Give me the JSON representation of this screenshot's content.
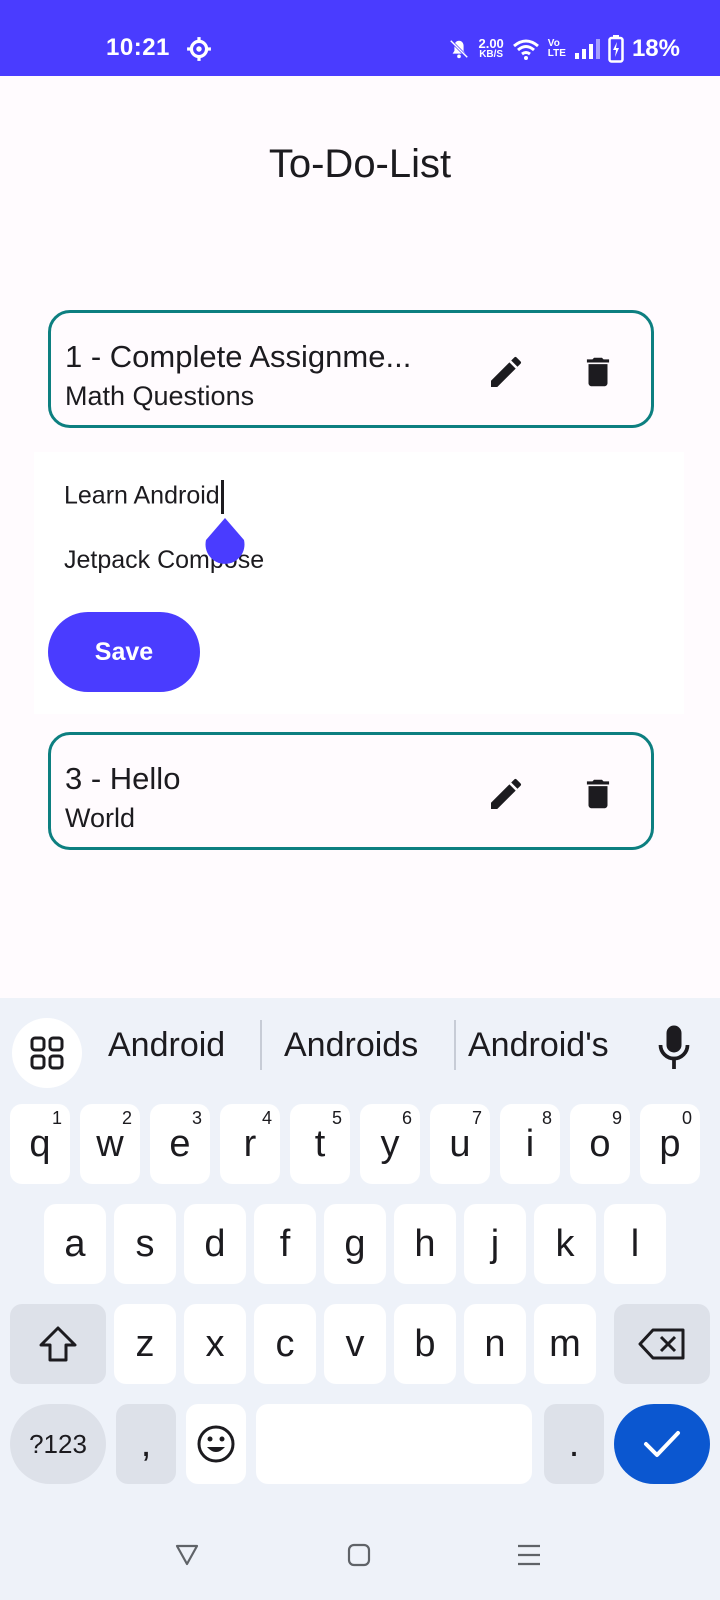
{
  "status_bar": {
    "time": "10:21",
    "net_speed_value": "2.00",
    "net_speed_unit": "KB/S",
    "volte_top": "Vo",
    "volte_bottom": "LTE",
    "battery": "18%"
  },
  "app": {
    "title": "To-Do-List"
  },
  "todos": [
    {
      "title": "1 - Complete Assignme...",
      "subtitle": "Math Questions"
    },
    {
      "title": "3 - Hello",
      "subtitle": "World"
    }
  ],
  "edit": {
    "title_value": "Learn Android",
    "description_value": "Jetpack Compose",
    "save_label": "Save"
  },
  "keyboard": {
    "suggestions": [
      "Android",
      "Androids",
      "Android's"
    ],
    "row1": [
      {
        "key": "q",
        "hint": "1"
      },
      {
        "key": "w",
        "hint": "2"
      },
      {
        "key": "e",
        "hint": "3"
      },
      {
        "key": "r",
        "hint": "4"
      },
      {
        "key": "t",
        "hint": "5"
      },
      {
        "key": "y",
        "hint": "6"
      },
      {
        "key": "u",
        "hint": "7"
      },
      {
        "key": "i",
        "hint": "8"
      },
      {
        "key": "o",
        "hint": "9"
      },
      {
        "key": "p",
        "hint": "0"
      }
    ],
    "row2": [
      "a",
      "s",
      "d",
      "f",
      "g",
      "h",
      "j",
      "k",
      "l"
    ],
    "row3": [
      "z",
      "x",
      "c",
      "v",
      "b",
      "n",
      "m"
    ],
    "symbols_label": "?123",
    "comma": ",",
    "period": "."
  },
  "colors": {
    "accent": "#4a3cff",
    "card_border": "#0d7f80",
    "enter_key": "#0b57d0"
  },
  "icons": [
    "settings-gear-icon",
    "mute-bell-icon",
    "wifi-icon",
    "signal-icon",
    "battery-icon",
    "edit-pencil-icon",
    "delete-trash-icon",
    "apps-grid-icon",
    "mic-icon",
    "shift-icon",
    "backspace-icon",
    "emoji-icon",
    "check-icon",
    "nav-back-icon",
    "nav-home-icon",
    "nav-recents-icon"
  ]
}
